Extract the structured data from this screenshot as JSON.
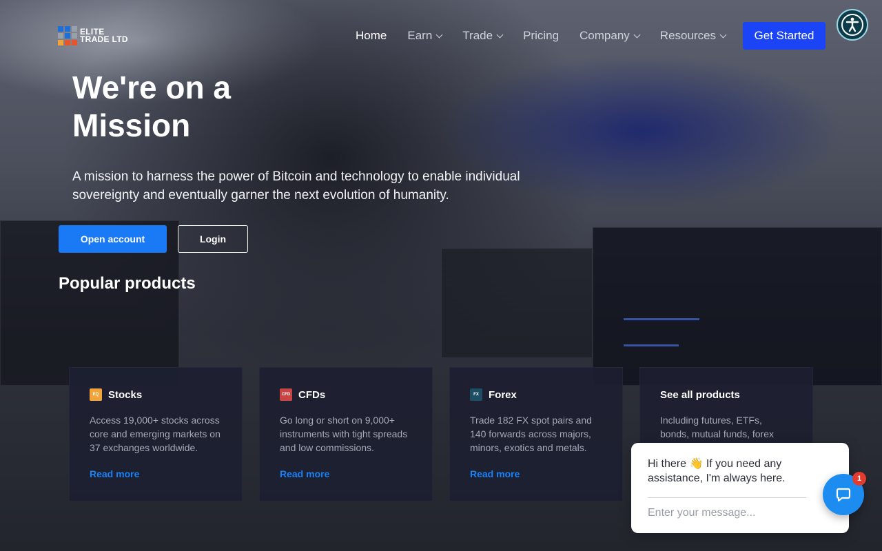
{
  "brand": {
    "name_line1": "ELITE",
    "name_line2": "TRADE LTD"
  },
  "nav": {
    "items": [
      {
        "label": "Home",
        "dropdown": false,
        "active": true
      },
      {
        "label": "Earn",
        "dropdown": true,
        "active": false
      },
      {
        "label": "Trade",
        "dropdown": true,
        "active": false
      },
      {
        "label": "Pricing",
        "dropdown": false,
        "active": false
      },
      {
        "label": "Company",
        "dropdown": true,
        "active": false
      },
      {
        "label": "Resources",
        "dropdown": true,
        "active": false
      }
    ],
    "cta_label": "Get Started",
    "accessibility_icon": "accessibility-icon"
  },
  "hero": {
    "title_line1": "We're on a",
    "title_line2": "Mission",
    "subtitle": "A mission to harness the power of Bitcoin and technology to enable individual sovereignty and eventually garner the next evolution of humanity.",
    "open_account_label": "Open account",
    "login_label": "Login"
  },
  "products": {
    "section_title": "Popular products",
    "cards": [
      {
        "badge": "EQ",
        "badge_color": "#f0a43a",
        "title": "Stocks",
        "description": "Access 19,000+ stocks across core and emerging markets on 37 exchanges worldwide.",
        "link": "Read more"
      },
      {
        "badge": "CFD",
        "badge_color": "#c94444",
        "title": "CFDs",
        "description": "Go long or short on 9,000+ instruments with tight spreads and low commissions.",
        "link": "Read more"
      },
      {
        "badge": "FX",
        "badge_color": "#1d4e63",
        "title": "Forex",
        "description": "Trade 182 FX spot pairs and 140 forwards across majors, minors, exotics and metals.",
        "link": "Read more"
      },
      {
        "badge": "",
        "badge_color": "",
        "title": "See all products",
        "description": "Including futures, ETFs, bonds, mutual funds, forex",
        "link": ""
      }
    ]
  },
  "chat": {
    "greeting": "Hi there 👋 If you need any assistance, I'm always here.",
    "input_placeholder": "Enter your message...",
    "unread_count": "1"
  },
  "colors": {
    "primary_blue": "#1a44f5",
    "button_blue": "#1a7af5",
    "link_blue": "#1a82f5",
    "card_bg": "#1d1f30"
  }
}
